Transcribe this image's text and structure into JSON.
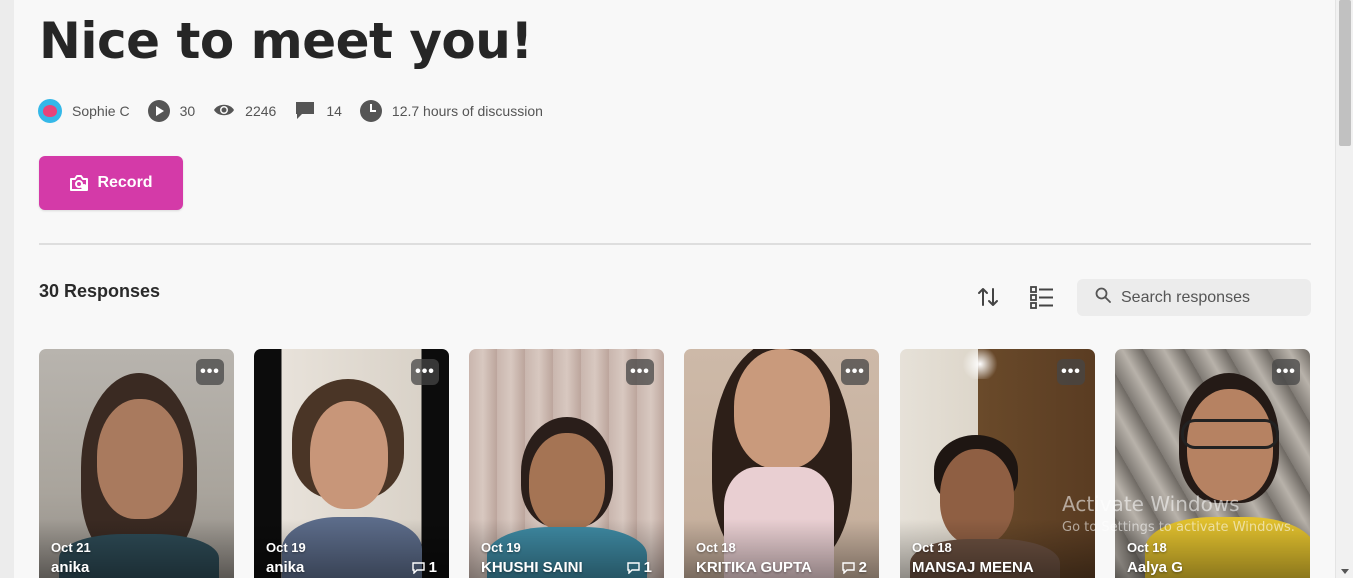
{
  "header": {
    "title": "Nice to meet you!"
  },
  "meta": {
    "author": "Sophie C",
    "responses_count": "30",
    "views": "2246",
    "comments": "14",
    "discussion": "12.7 hours of discussion"
  },
  "record": {
    "label": "Record"
  },
  "responses": {
    "heading": "30 Responses",
    "search_placeholder": "Search responses"
  },
  "cards": [
    {
      "date": "Oct 21",
      "name": "anika",
      "comments": ""
    },
    {
      "date": "Oct 19",
      "name": "anika",
      "comments": "1"
    },
    {
      "date": "Oct 19",
      "name": "KHUSHI SAINI",
      "comments": "1"
    },
    {
      "date": "Oct 18",
      "name": "KRITIKA GUPTA",
      "comments": "2"
    },
    {
      "date": "Oct 18",
      "name": "MANSAJ MEENA",
      "comments": ""
    },
    {
      "date": "Oct 18",
      "name": "Aalya G",
      "comments": ""
    }
  ],
  "watermark": {
    "line1": "Activate Windows",
    "line2": "Go to Settings to activate Windows."
  },
  "colors": {
    "accent": "#d43aa8",
    "background": "#f8f8f8"
  }
}
